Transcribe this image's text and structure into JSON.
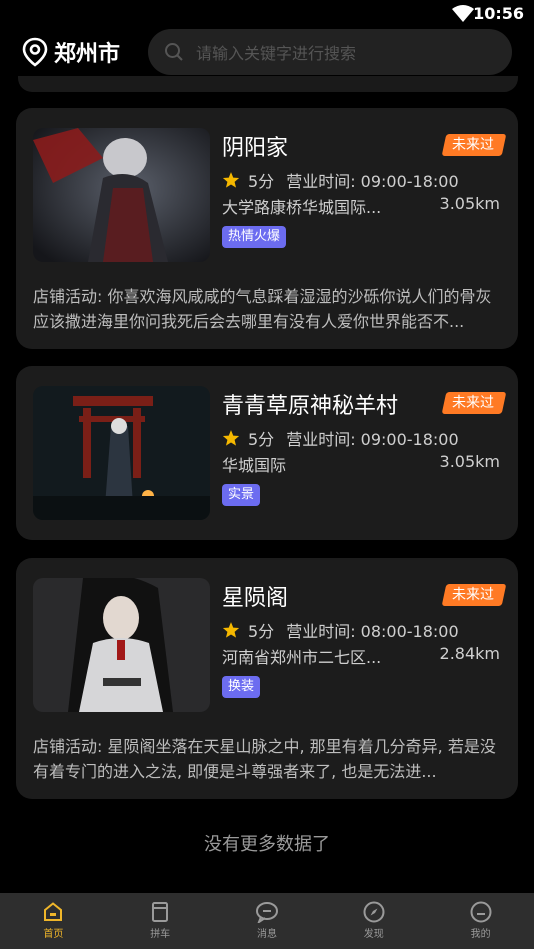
{
  "status_bar": {
    "time": "10:56"
  },
  "header": {
    "city": "郑州市",
    "search_placeholder": "请输入关键字进行搜索"
  },
  "shops": [
    {
      "name": "阴阳家",
      "visit_badge": "未来过",
      "score": "5分",
      "hours": "营业时间: 09:00-18:00",
      "address": "大学路康桥华城国际...",
      "distance": "3.05km",
      "tag": "热情火爆",
      "activity": "店铺活动: 你喜欢海风咸咸的气息踩着湿湿的沙砾你说人们的骨灰应该撒进海里你问我死后会去哪里有没有人爱你世界能否不..."
    },
    {
      "name": "青青草原神秘羊村",
      "visit_badge": "未来过",
      "score": "5分",
      "hours": "营业时间: 09:00-18:00",
      "address": "华城国际",
      "distance": "3.05km",
      "tag": "实景",
      "activity": ""
    },
    {
      "name": "星陨阁",
      "visit_badge": "未来过",
      "score": "5分",
      "hours": "营业时间: 08:00-18:00",
      "address": "河南省郑州市二七区...",
      "distance": "2.84km",
      "tag": "换装",
      "activity": "店铺活动: 星陨阁坐落在天星山脉之中, 那里有着几分奇异, 若是没有着专门的进入之法, 即便是斗尊强者来了, 也是无法进..."
    }
  ],
  "footer": {
    "no_more": "没有更多数据了"
  },
  "tabbar": [
    {
      "label": "首页",
      "icon": "home-icon",
      "active": true
    },
    {
      "label": "拼车",
      "icon": "book-icon",
      "active": false
    },
    {
      "label": "消息",
      "icon": "chat-icon",
      "active": false
    },
    {
      "label": "发现",
      "icon": "compass-icon",
      "active": false
    },
    {
      "label": "我的",
      "icon": "profile-icon",
      "active": false
    }
  ],
  "colors": {
    "accent": "#f0b62a",
    "badge": "#ff7a24",
    "tag": "#6c6cf0",
    "card": "#1c1c1c"
  }
}
